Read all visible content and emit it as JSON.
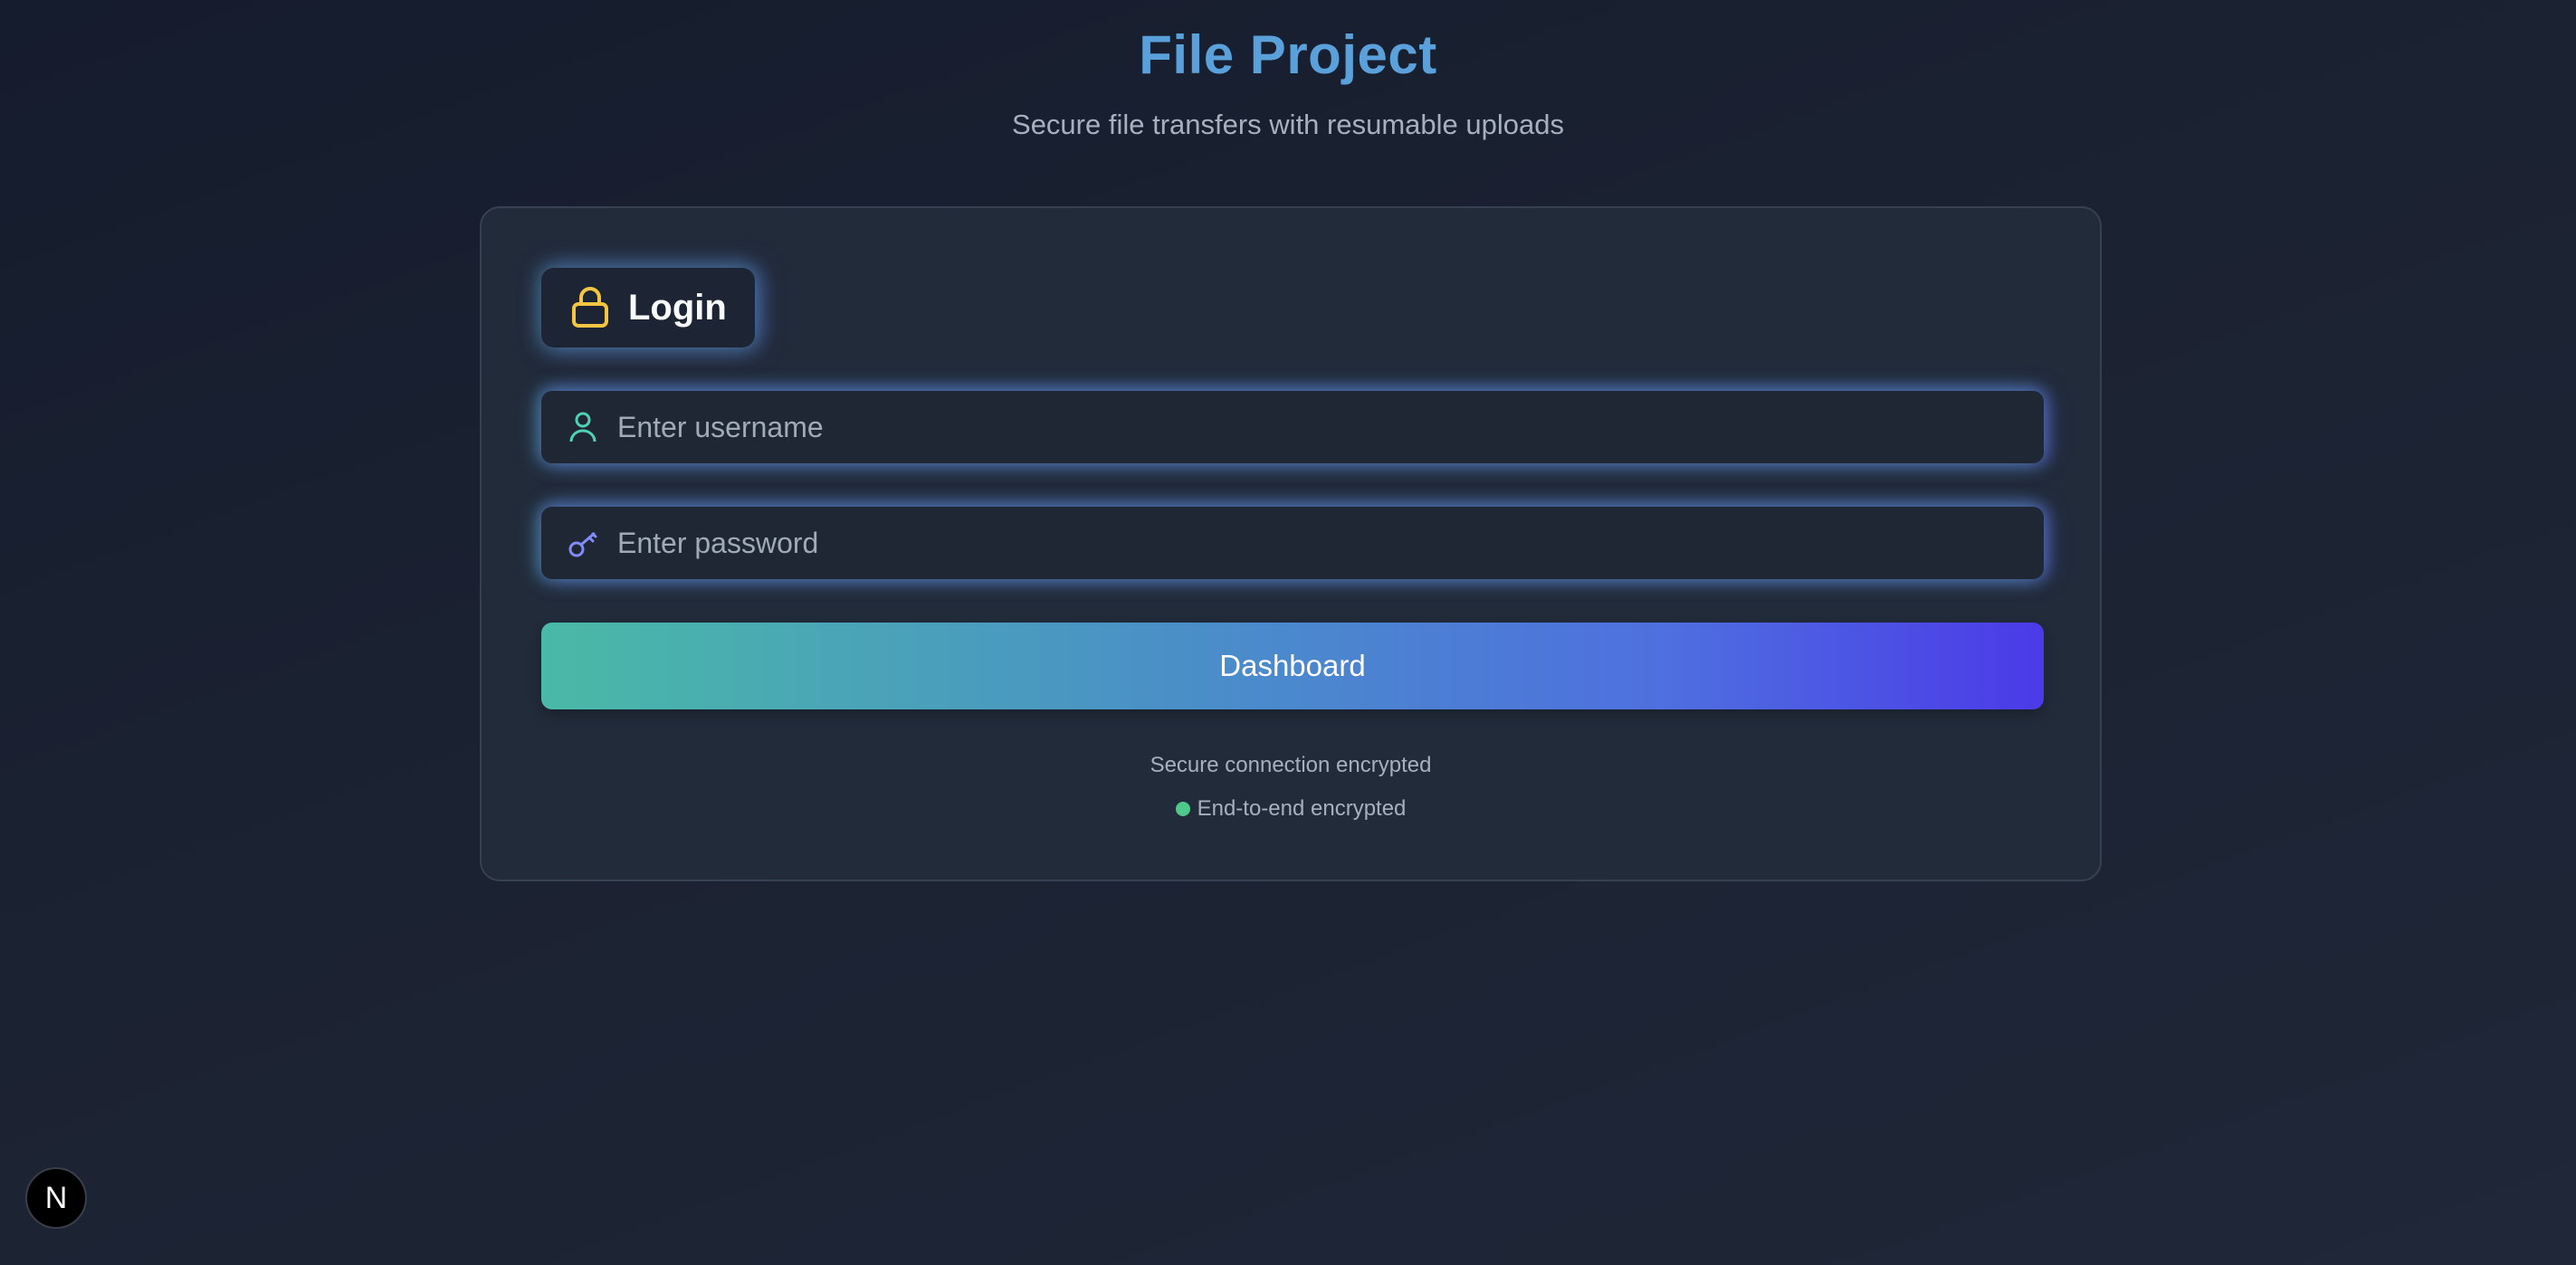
{
  "header": {
    "title": "File Project",
    "subtitle": "Secure file transfers with resumable uploads"
  },
  "login_card": {
    "badge_label": "Login",
    "badge_icon": "lock-icon",
    "username": {
      "placeholder": "Enter username",
      "value": "",
      "icon": "user-icon"
    },
    "password": {
      "placeholder": "Enter password",
      "value": "",
      "icon": "key-icon"
    },
    "submit_label": "Dashboard",
    "secure_note": "Secure connection encrypted",
    "encryption_status": "End-to-end encrypted"
  },
  "corner_badge": {
    "label": "N"
  },
  "colors": {
    "title": "#5aa0da",
    "lock_icon": "#f4c542",
    "user_icon": "#4fd1b5",
    "key_icon": "#818cf8",
    "status_dot": "#4ec98a",
    "button_gradient_start": "#4ab9a7",
    "button_gradient_end": "#4b3ae8"
  }
}
